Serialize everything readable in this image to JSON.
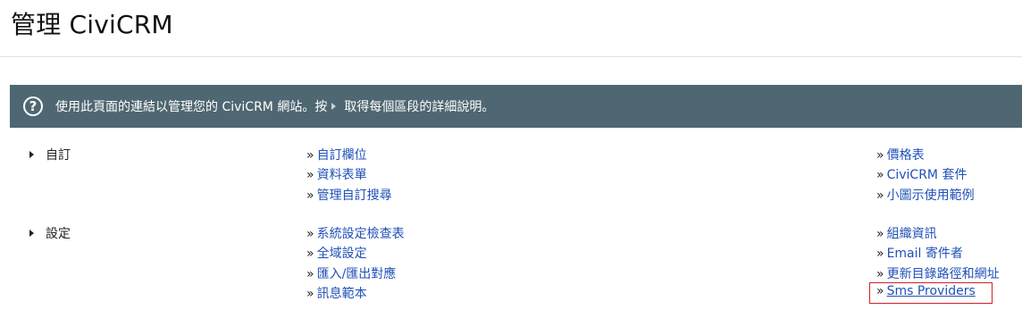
{
  "header": {
    "title": "管理 CiviCRM"
  },
  "help": {
    "icon": "question-circle-icon",
    "text_before": "使用此頁面的連結以管理您的 CiviCRM 網站。按",
    "text_after": "取得每個區段的詳細說明。"
  },
  "sections": [
    {
      "toggle_label": "自訂",
      "middle_links": [
        "自訂欄位",
        "資料表單",
        "管理自訂搜尋"
      ],
      "right_links": [
        "價格表",
        "CiviCRM 套件",
        "小圖示使用範例"
      ]
    },
    {
      "toggle_label": "設定",
      "middle_links": [
        "系統設定檢查表",
        "全域設定",
        "匯入/匯出對應",
        "訊息範本"
      ],
      "right_links": [
        "組織資訊",
        "Email 寄件者",
        "更新目錄路徑和網址",
        "Sms Providers"
      ]
    }
  ],
  "link_prefix": "»",
  "colors": {
    "help_bar": "#4f6772",
    "link": "#2050b8",
    "highlight": "#d0202a"
  }
}
